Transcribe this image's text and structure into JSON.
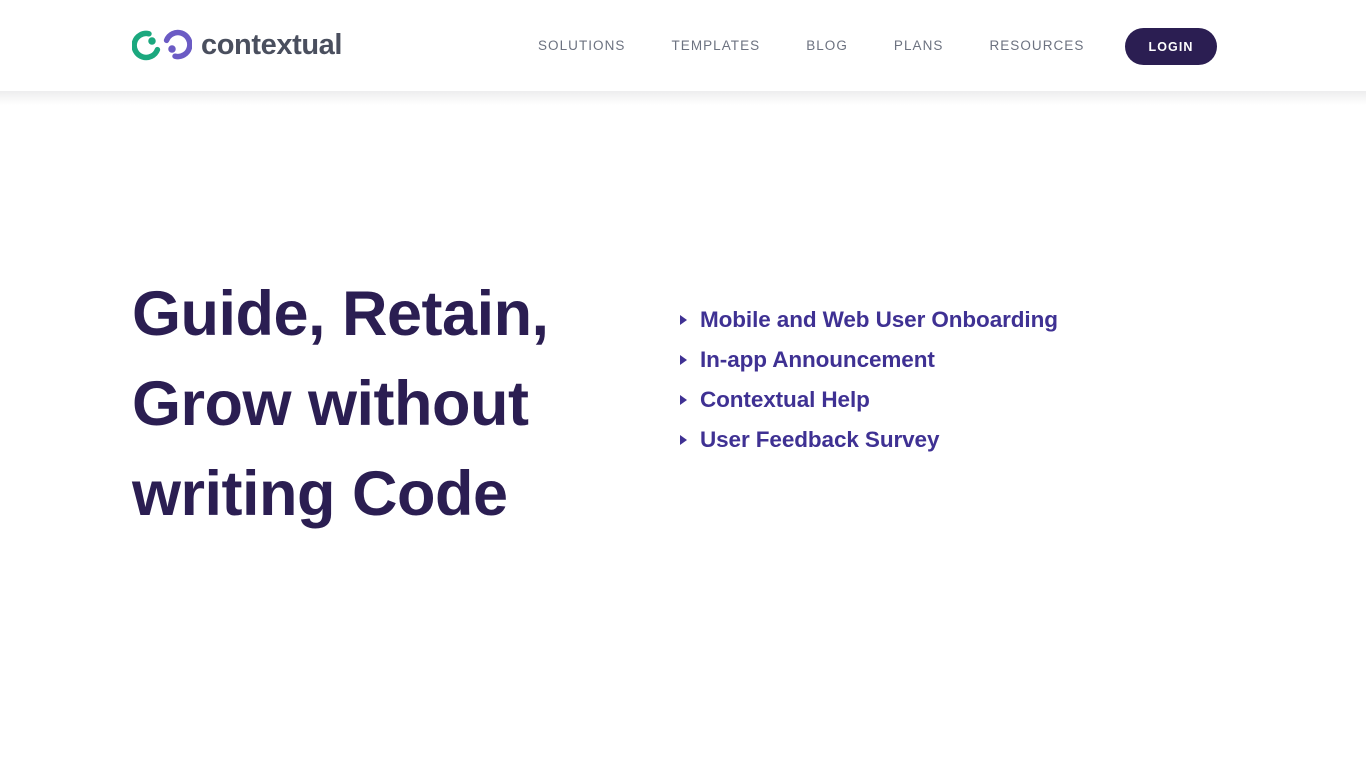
{
  "header": {
    "brand": {
      "word": "contextual",
      "logo_icon": "contextual-dual-arc-logo",
      "green_color": "#1ba87e",
      "purple_color": "#6b5bc4",
      "word_color": "#4a4f5e"
    },
    "nav": [
      {
        "label": "SOLUTIONS",
        "name": "nav-link-solutions"
      },
      {
        "label": "TEMPLATES",
        "name": "nav-link-templates"
      },
      {
        "label": "BLOG",
        "name": "nav-link-blog"
      },
      {
        "label": "PLANS",
        "name": "nav-link-plans"
      },
      {
        "label": "RESOURCES",
        "name": "nav-link-resources"
      }
    ],
    "login_label": "LOGIN",
    "login_bg": "#2b1e52"
  },
  "hero": {
    "title": "Guide, Retain, Grow without writing Code",
    "title_color": "#2b1e52",
    "features": [
      {
        "label": "Mobile and Web User Onboarding",
        "bullet_icon": "caret-right-icon"
      },
      {
        "label": "In-app Announcement",
        "bullet_icon": "caret-right-icon"
      },
      {
        "label": "Contextual Help",
        "bullet_icon": "caret-right-icon"
      },
      {
        "label": "User Feedback Survey",
        "bullet_icon": "caret-right-icon"
      }
    ],
    "feature_color": "#3f3193"
  }
}
